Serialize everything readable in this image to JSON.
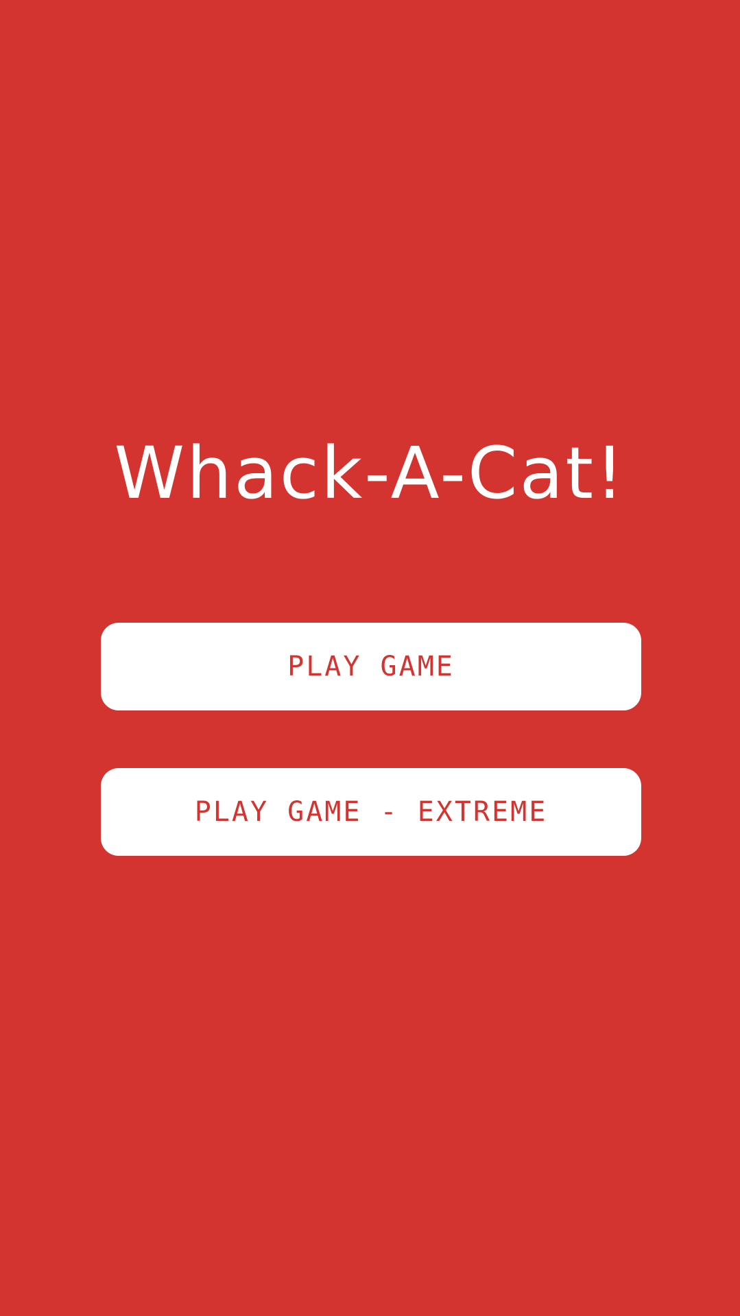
{
  "app": {
    "title": "Whack-A-Cat!"
  },
  "menu": {
    "play_label": "PLAY GAME",
    "extreme_label": "PLAY GAME - EXTREME"
  },
  "colors": {
    "background": "#d4342f",
    "button_background": "#ffffff",
    "button_text": "#d4342f",
    "title_text": "#ffffff"
  }
}
